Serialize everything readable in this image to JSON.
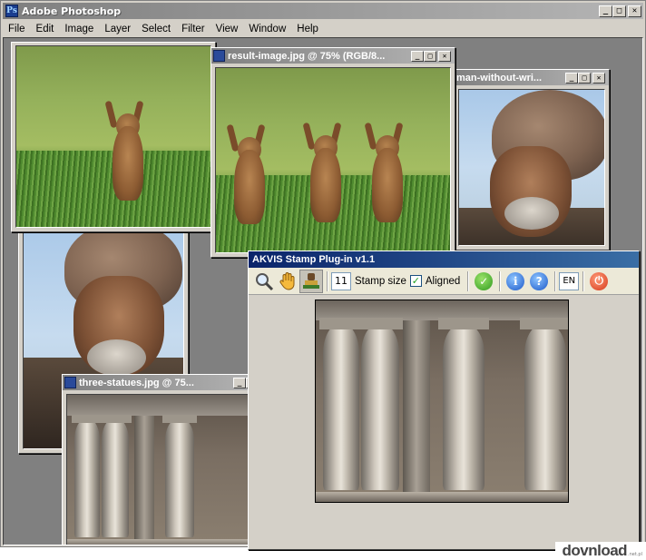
{
  "app": {
    "title": "Adobe Photoshop",
    "logo_letter": "Ps",
    "window_buttons": {
      "minimize": "_",
      "maximize": "□",
      "close": "✕"
    }
  },
  "menubar": {
    "items": [
      "File",
      "Edit",
      "Image",
      "Layer",
      "Select",
      "Filter",
      "View",
      "Window",
      "Help"
    ]
  },
  "documents": {
    "result": {
      "title": "result-image.jpg @ 75% (RGB/8..."
    },
    "man": {
      "title": "man-without-wri..."
    },
    "statues": {
      "title": "three-statues.jpg @ 75..."
    }
  },
  "akvis": {
    "title": "AKVIS Stamp Plug-in v1.1",
    "stamp_size_value": "11",
    "stamp_size_label": "Stamp size",
    "aligned_label": "Aligned",
    "aligned_checked": "✓",
    "language": "EN",
    "icons": [
      "zoom-icon",
      "hand-icon",
      "stamp-icon",
      "apply-icon",
      "info-icon",
      "help-icon",
      "exit-icon"
    ]
  },
  "watermark": {
    "text": "dovnload",
    "suffix": ".net.pl"
  }
}
